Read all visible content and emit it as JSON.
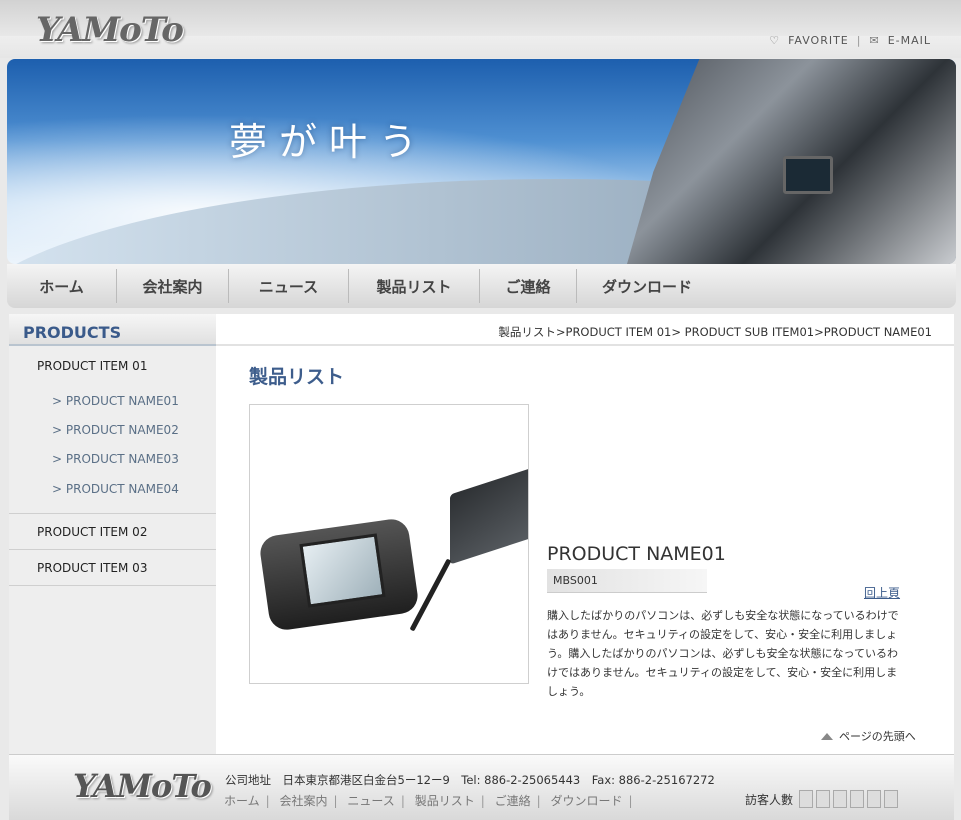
{
  "header": {
    "logo": "YAMoTo",
    "favorite": "FAVORITE",
    "email": "E-MAIL",
    "favorite_icon": "heart-icon",
    "email_icon": "mail-icon"
  },
  "banner": {
    "slogan": "夢が叶う"
  },
  "nav": {
    "items": [
      "ホーム",
      "会社案内",
      "ニュース",
      "製品リスト",
      "ご連絡",
      "ダウンロード"
    ]
  },
  "sidebar": {
    "title": "PRODUCTS",
    "categories": [
      {
        "label": "PRODUCT ITEM 01",
        "subs": [
          "> PRODUCT NAME01",
          "> PRODUCT NAME02",
          "> PRODUCT NAME03",
          "> PRODUCT NAME04"
        ]
      },
      {
        "label": "PRODUCT ITEM 02"
      },
      {
        "label": "PRODUCT ITEM 03"
      }
    ]
  },
  "main": {
    "breadcrumb": "製品リスト>PRODUCT ITEM 01> PRODUCT SUB ITEM01>PRODUCT NAME01",
    "title": "製品リスト",
    "product_name": "PRODUCT NAME01",
    "product_code": "MBS001",
    "back_link": "回上頁",
    "description": "購入したばかりのパソコンは、必ずしも安全な状態になっているわけではありません。セキュリティの設定をして、安心・安全に利用しましょう。購入したばかりのパソコンは、必ずしも安全な状態になっているわけではありません。セキュリティの設定をして、安心・安全に利用しましょう。",
    "page_top": "ページの先頭へ"
  },
  "footer": {
    "logo": "YAMoTo",
    "address": "公司地址　日本東京都港区白金台5ー12ー9　Tel: 886-2-25065443　Fax: 886-2-25167272",
    "links": [
      "ホーム",
      "会社案内",
      "ニュース",
      "製品リスト",
      "ご連絡",
      "ダウンロード"
    ],
    "visitors_label": "訪客人數"
  },
  "colors": {
    "accent": "#3d5d8c",
    "sidebar_link": "#5a6f86"
  }
}
